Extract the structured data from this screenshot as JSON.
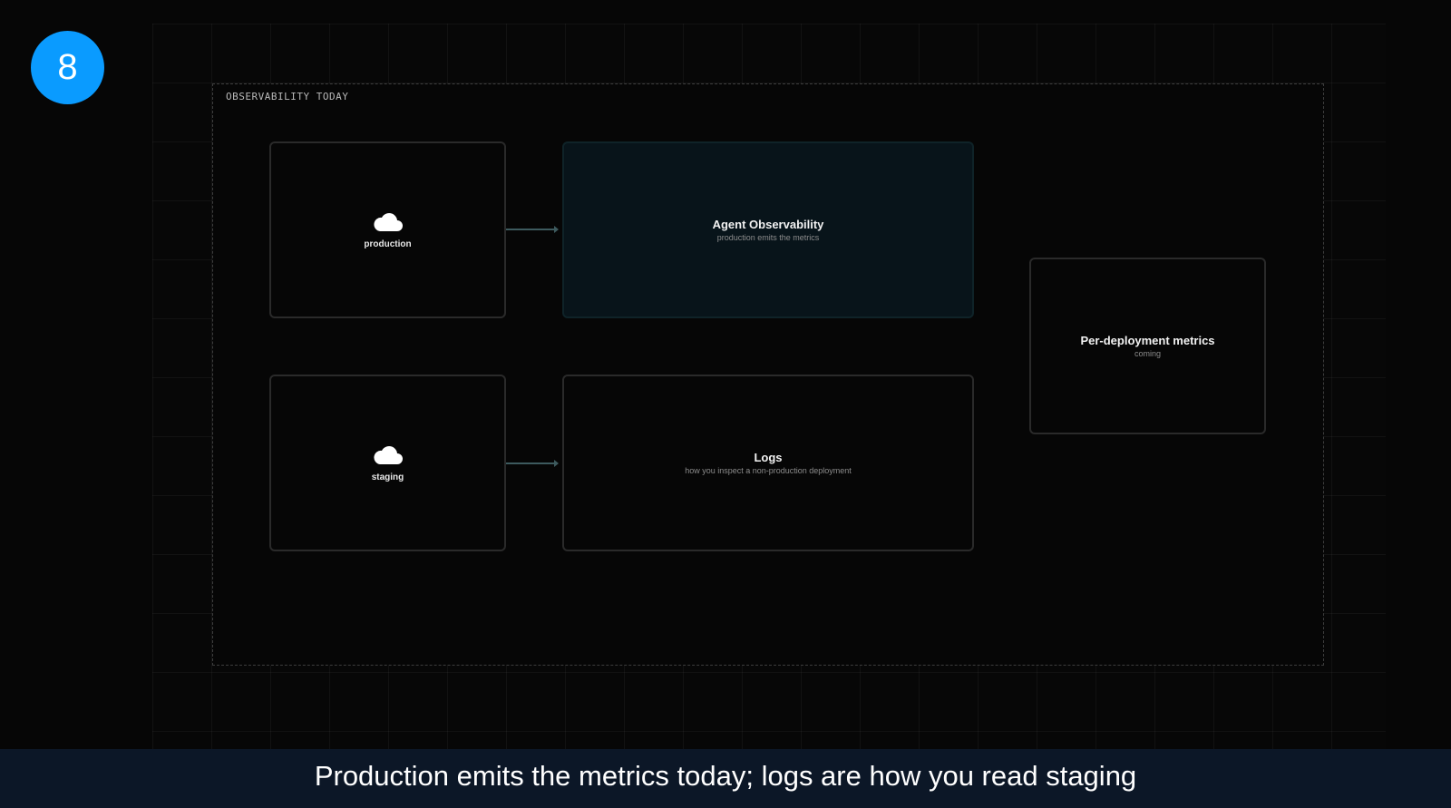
{
  "badge": {
    "number": "8"
  },
  "diagram": {
    "section_label": "OBSERVABILITY TODAY",
    "sources": [
      {
        "label": "production",
        "icon": "cloud-icon"
      },
      {
        "label": "staging",
        "icon": "cloud-icon"
      }
    ],
    "targets": [
      {
        "title": "Agent Observability",
        "subtitle": "production emits the metrics"
      },
      {
        "title": "Logs",
        "subtitle": "how you inspect a non-production deployment"
      }
    ],
    "future": {
      "title": "Per-deployment metrics",
      "subtitle": "coming"
    }
  },
  "caption": "Production emits the metrics today; logs are how you read staging",
  "colors": {
    "badge": "#0a9bff",
    "caption_bar": "#0c1727",
    "highlight_node": "#08141a",
    "arrow": "#3d5a5e"
  }
}
